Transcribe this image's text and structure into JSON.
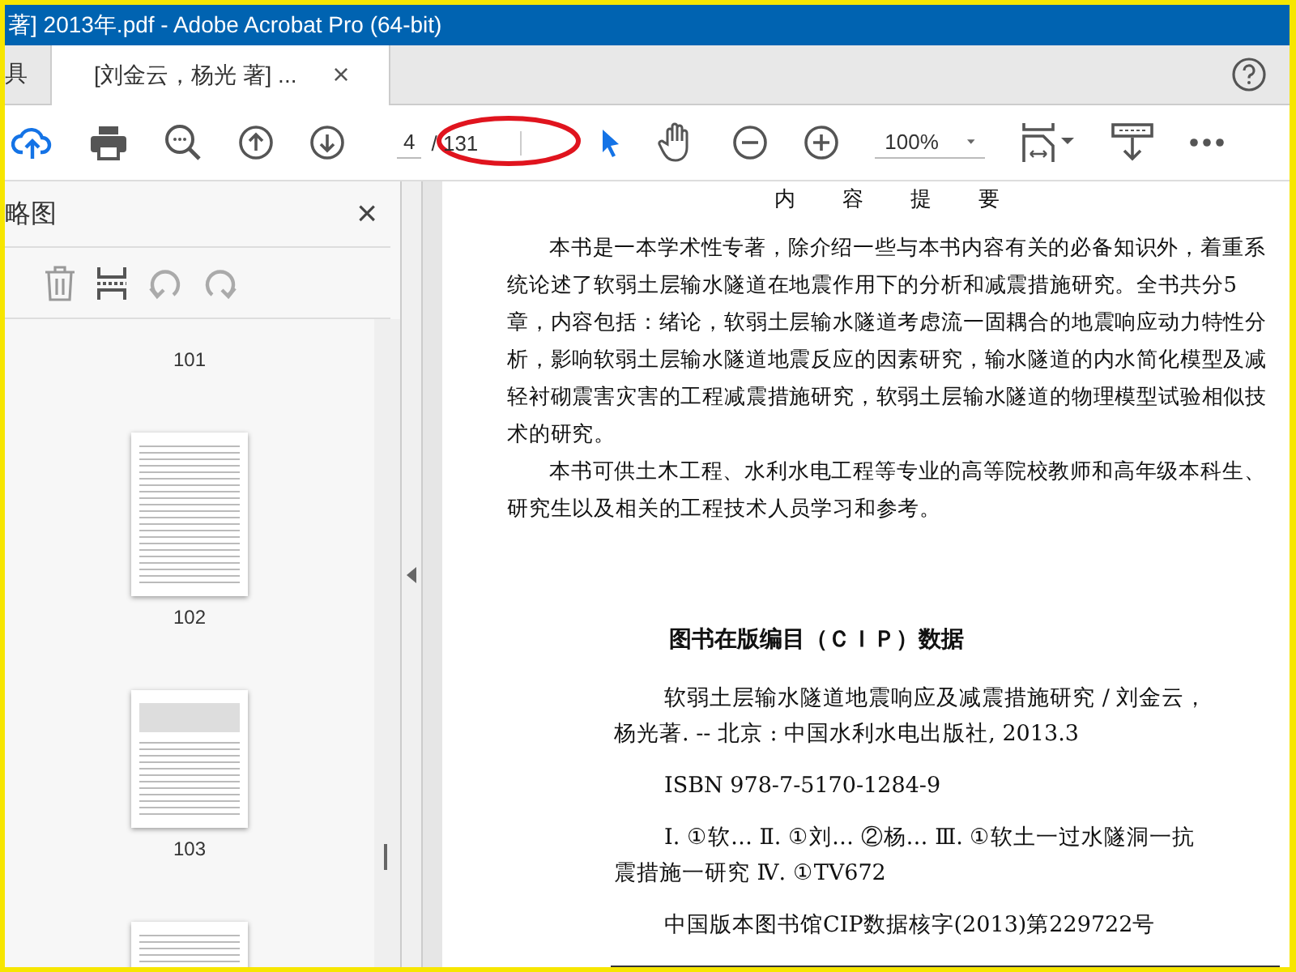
{
  "window": {
    "title": "著] 2013年.pdf - Adobe Acrobat Pro (64-bit)"
  },
  "tabs": [
    {
      "label": "具",
      "selected": false
    },
    {
      "label": "[刘金云，杨光 著] ...",
      "selected": true,
      "close": "×"
    }
  ],
  "toolbar": {
    "page_current": "4",
    "page_total": "/ 131",
    "zoom": "100%"
  },
  "sidebar": {
    "title": "略图",
    "close": "×",
    "first_label": "101",
    "thumbnails": [
      {
        "label": "102",
        "kind": "text"
      },
      {
        "label": "103",
        "kind": "figure"
      }
    ]
  },
  "document": {
    "heading": "内　容　提　要",
    "paragraphs": [
      "本书是一本学术性专著，除介绍一些与本书内容有关的必备知识外，着重系统论述了软弱土层输水隧道在地震作用下的分析和减震措施研究。全书共分5章，内容包括：绪论，软弱土层输水隧道考虑流一固耦合的地震响应动力特性分析，影响软弱土层输水隧道地震反应的因素研究，输水隧道的内水简化模型及减轻衬砌震害灾害的工程减震措施研究，软弱土层输水隧道的物理模型试验相似技术的研究。",
      "本书可供土木工程、水利水电工程等专业的高等院校教师和高年级本科生、研究生以及相关的工程技术人员学习和参考。"
    ],
    "cip_title": "图书在版编目（ＣＩＰ）数据",
    "cip_entries": [
      "软弱土层输水隧道地震响应及减震措施研究 / 刘金云，杨光著. -- 北京 : 中国水利水电出版社, 2013.3",
      "ISBN 978-7-5170-1284-9",
      "Ⅰ. ①软… Ⅱ. ①刘… ②杨… Ⅲ. ①软土一过水隧洞一抗震措施一研究 Ⅳ. ①TV672",
      "中国版本图书馆CIP数据核字(2013)第229722号"
    ]
  }
}
